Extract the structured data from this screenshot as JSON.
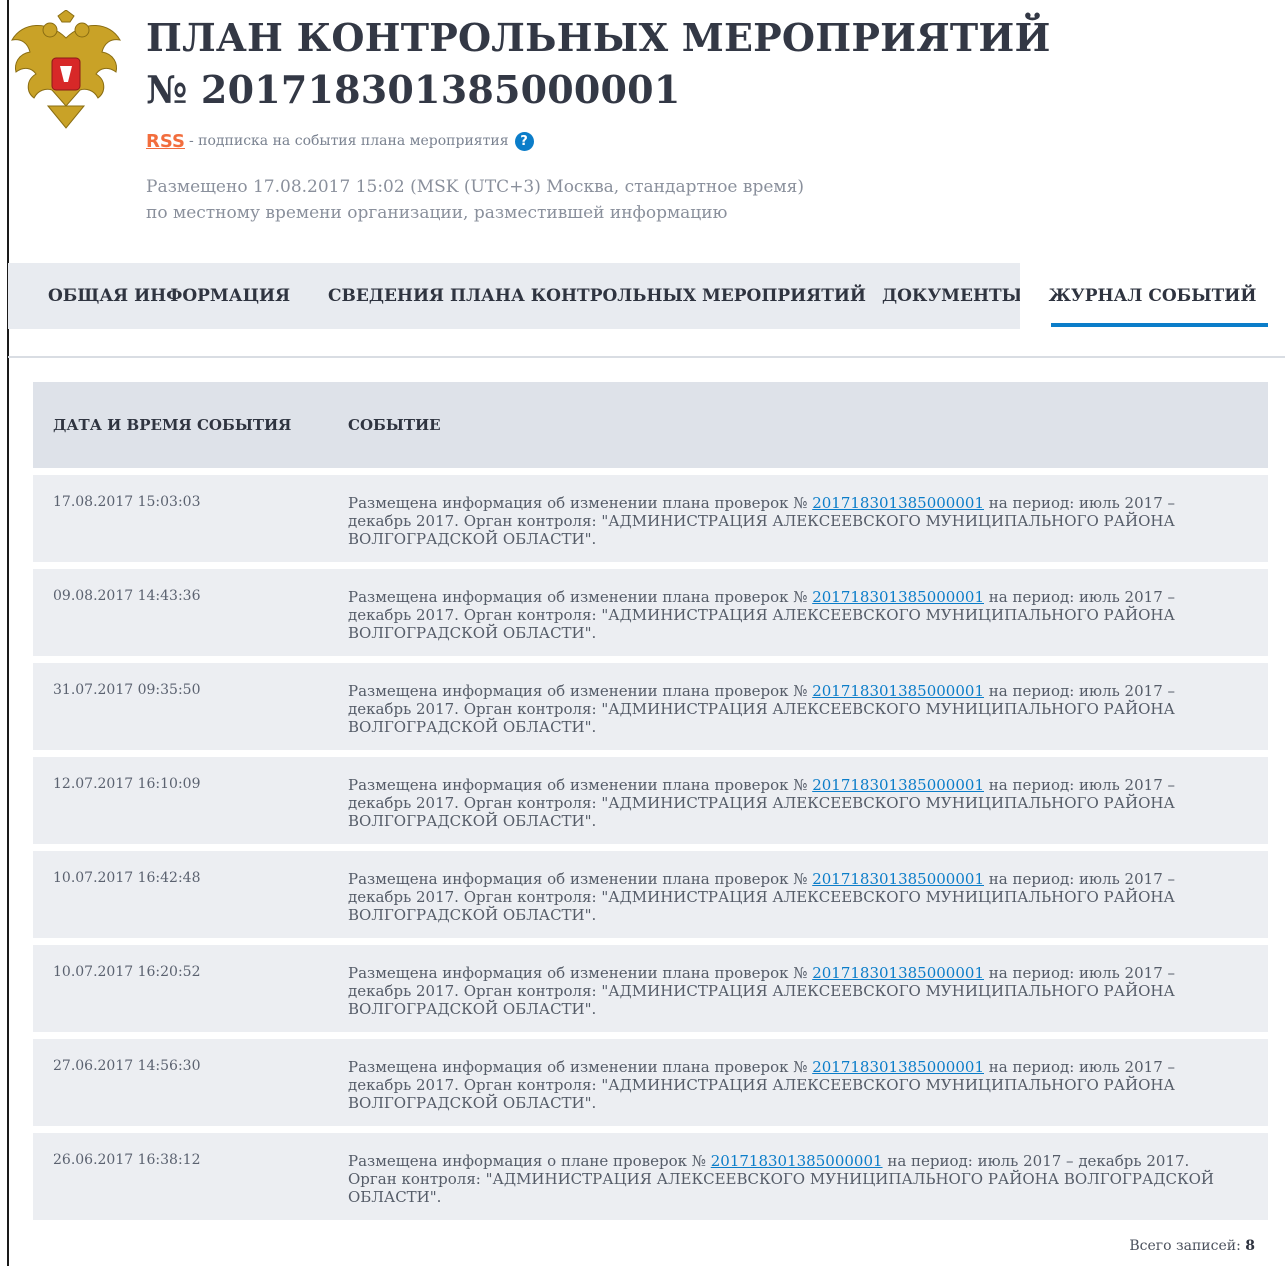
{
  "header": {
    "title_line1": "ПЛАН КОНТРОЛЬНЫХ МЕРОПРИЯТИЙ",
    "title_line2": "№ 2017183013850000​01",
    "rss_label": "RSS",
    "rss_text": "- подписка на события плана мероприятия",
    "help_icon": "?",
    "posted_line1": "Размещено 17.08.2017 15:02 (MSK (UTC+3) Москва, стандартное время)",
    "posted_line2": "по местному времени организации, разместившей информацию"
  },
  "tabs": [
    {
      "label": "ОБЩАЯ ИНФОРМАЦИЯ",
      "active": false
    },
    {
      "label": "СВЕДЕНИЯ ПЛАНА КОНТРОЛЬНЫХ МЕРОПРИЯТИЙ",
      "active": false
    },
    {
      "label": "ДОКУМЕНТЫ",
      "active": false
    },
    {
      "label": "ЖУРНАЛ СОБЫТИЙ",
      "active": true
    }
  ],
  "table": {
    "columns": [
      "ДАТА И ВРЕМЯ СОБЫТИЯ",
      "СОБЫТИЕ"
    ],
    "rows": [
      {
        "date": "17.08.2017 15:03:03",
        "pre": "Размещена информация об изменении плана проверок № ",
        "link": "2017183013850000​01",
        "post": " на период: июль 2017 – декабрь 2017. Орган контроля: \"АДМИНИСТРАЦИЯ АЛЕКСЕЕВСКОГО МУНИЦИПАЛЬНОГО РАЙОНА ВОЛГОГРАДСКОЙ ОБЛАСТИ\"."
      },
      {
        "date": "09.08.2017 14:43:36",
        "pre": "Размещена информация об изменении плана проверок № ",
        "link": "2017183013850000​01",
        "post": " на период: июль 2017 – декабрь 2017. Орган контроля: \"АДМИНИСТРАЦИЯ АЛЕКСЕЕВСКОГО МУНИЦИПАЛЬНОГО РАЙОНА ВОЛГОГРАДСКОЙ ОБЛАСТИ\"."
      },
      {
        "date": "31.07.2017 09:35:50",
        "pre": "Размещена информация об изменении плана проверок № ",
        "link": "2017183013850000​01",
        "post": " на период: июль 2017 – декабрь 2017. Орган контроля: \"АДМИНИСТРАЦИЯ АЛЕКСЕЕВСКОГО МУНИЦИПАЛЬНОГО РАЙОНА ВОЛГОГРАДСКОЙ ОБЛАСТИ\"."
      },
      {
        "date": "12.07.2017 16:10:09",
        "pre": "Размещена информация об изменении плана проверок № ",
        "link": "2017183013850000​01",
        "post": " на период: июль 2017 – декабрь 2017. Орган контроля: \"АДМИНИСТРАЦИЯ АЛЕКСЕЕВСКОГО МУНИЦИПАЛЬНОГО РАЙОНА ВОЛГОГРАДСКОЙ ОБЛАСТИ\"."
      },
      {
        "date": "10.07.2017 16:42:48",
        "pre": "Размещена информация об изменении плана проверок № ",
        "link": "2017183013850000​01",
        "post": " на период: июль 2017 – декабрь 2017. Орган контроля: \"АДМИНИСТРАЦИЯ АЛЕКСЕЕВСКОГО МУНИЦИПАЛЬНОГО РАЙОНА ВОЛГОГРАДСКОЙ ОБЛАСТИ\"."
      },
      {
        "date": "10.07.2017 16:20:52",
        "pre": "Размещена информация об изменении плана проверок № ",
        "link": "2017183013850000​01",
        "post": " на период: июль 2017 – декабрь 2017. Орган контроля: \"АДМИНИСТРАЦИЯ АЛЕКСЕЕВСКОГО МУНИЦИПАЛЬНОГО РАЙОНА ВОЛГОГРАДСКОЙ ОБЛАСТИ\"."
      },
      {
        "date": "27.06.2017 14:56:30",
        "pre": "Размещена информация об изменении плана проверок № ",
        "link": "2017183013850000​01",
        "post": " на период: июль 2017 – декабрь 2017. Орган контроля: \"АДМИНИСТРАЦИЯ АЛЕКСЕЕВСКОГО МУНИЦИПАЛЬНОГО РАЙОНА ВОЛГОГРАДСКОЙ ОБЛАСТИ\"."
      },
      {
        "date": "26.06.2017 16:38:12",
        "pre": "Размещена информация о плане проверок № ",
        "link": "2017183013850000​01",
        "post": " на период: июль 2017 – декабрь 2017. Орган контроля: \"АДМИНИСТРАЦИЯ АЛЕКСЕЕВСКОГО МУНИЦИПАЛЬНОГО РАЙОНА ВОЛГОГРАДСКОЙ ОБЛАСТИ\"."
      }
    ]
  },
  "footer": {
    "total_label": "Всего записей: ",
    "total_value": "8"
  },
  "colors": {
    "accent": "#0b7dc9",
    "rss": "#f26d3d",
    "header_bg": "#dee2e9",
    "row_bg": "#eceef2"
  }
}
